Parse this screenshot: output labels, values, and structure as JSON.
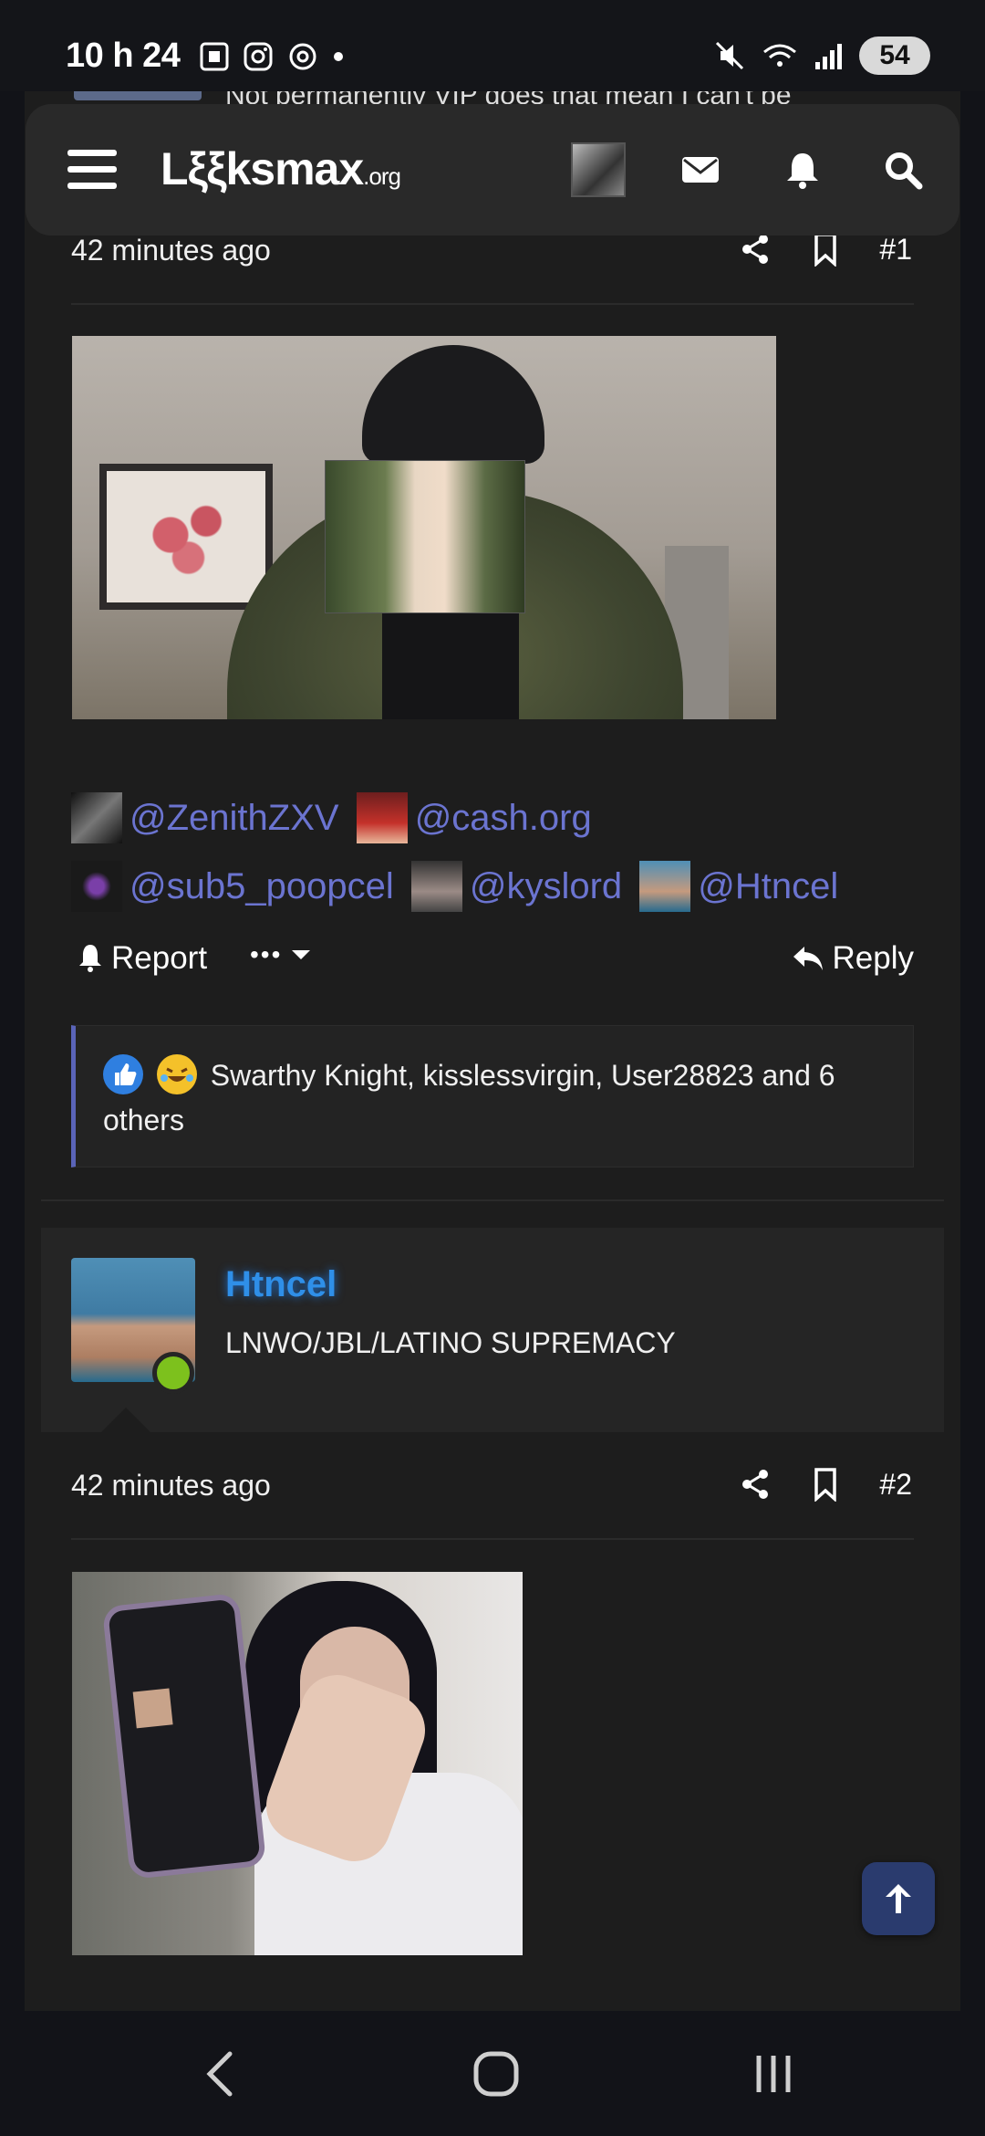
{
  "status_bar": {
    "time": "10 h 24",
    "battery": "54"
  },
  "header": {
    "logo_main": "Lξξksmax",
    "logo_suffix": ".org"
  },
  "peek": {
    "text": "Not permanently VIP does that mean I can't be"
  },
  "post1": {
    "time": "42 minutes ago",
    "number": "#1",
    "mentions": [
      "@ZenithZXV",
      "@cash.org",
      "@sub5_poopcel",
      "@kyslord",
      "@Htncel"
    ],
    "report_label": "Report",
    "more_label": "•••",
    "reply_label": "Reply",
    "reactions_text": "Swarthy Knight, kisslessvirgin, User28823 and 6 others"
  },
  "post2": {
    "username": "Htncel",
    "user_title": "LNWO/JBL/LATINO SUPREMACY",
    "time": "42 minutes ago",
    "number": "#2"
  },
  "colors": {
    "mention": "#6b74d0",
    "username": "#2f8fe8",
    "online": "#7dc11d",
    "accent_border": "#5a64b8"
  },
  "icons": [
    "menu-icon",
    "envelope-icon",
    "bell-icon",
    "search-icon",
    "share-icon",
    "bookmark-icon",
    "reply-icon",
    "like-icon",
    "laugh-icon",
    "arrow-up-icon"
  ]
}
